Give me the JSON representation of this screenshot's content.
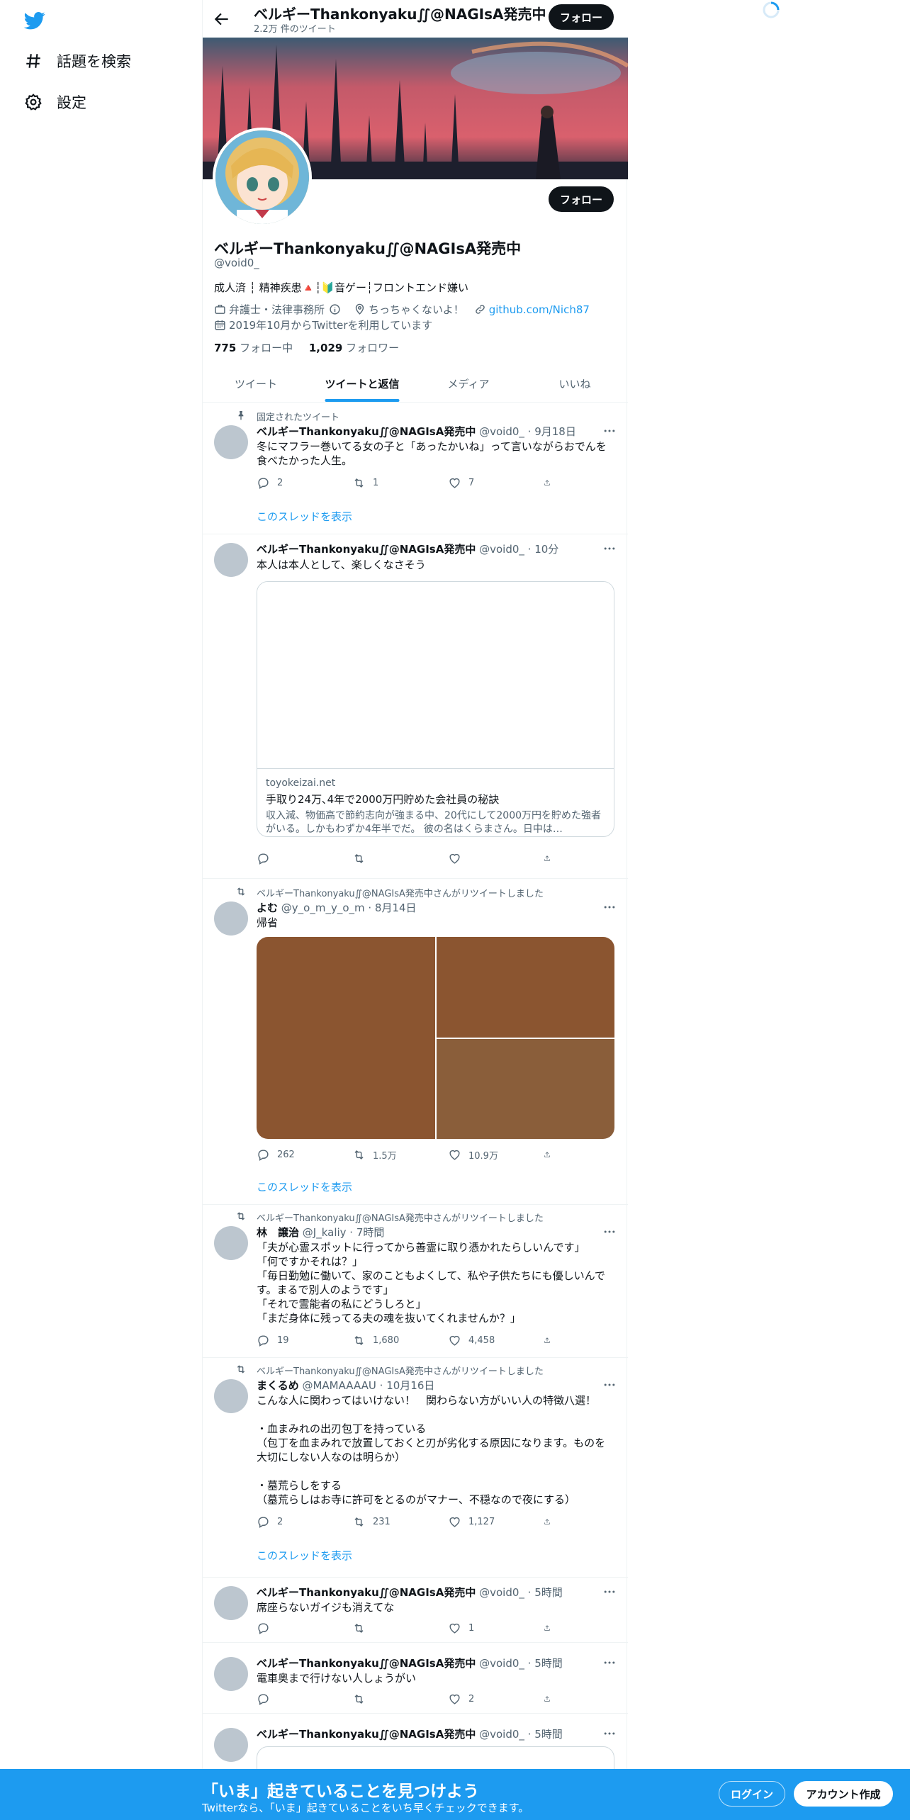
{
  "nav": {
    "explore_label": "話題を検索",
    "settings_label": "設定"
  },
  "header": {
    "name": "ベルギーThankonyaku∬@NAGIsA発売中",
    "tweet_count": "2.2万 件のツイート",
    "follow_label": "フォロー"
  },
  "profile": {
    "name": "ベルギーThankonyaku∬@NAGIsA発売中",
    "handle": "@void0_",
    "follow_label": "フォロー",
    "bio": "成人済 ┆ 精神疾患🔺┆🔰音ゲー┆フロントエンド嫌い",
    "category": "弁護士・法律事務所",
    "location": "ちっちゃくないよ！",
    "website": "github.com/Nich87",
    "joined": "2019年10月からTwitterを利用しています",
    "following_count": "775",
    "following_label": " フォロー中",
    "followers_count": "1,029",
    "followers_label": " フォロワー"
  },
  "tabs": [
    "ツイート",
    "ツイートと返信",
    "メディア",
    "いいね"
  ],
  "tweets": [
    {
      "context": "固定されたツイート",
      "name": "ベルギーThankonyaku∬@NAGIsA発売中",
      "handle_time": " @void0_ · 9月18日",
      "text": "冬にマフラー巻いてる女の子と「あったかいね」って言いながらおでんを食べたかった人生。",
      "reply": "2",
      "retweet": "1",
      "like": "7",
      "show_thread": "このスレッドを表示"
    },
    {
      "name": "ベルギーThankonyaku∬@NAGIsA発売中",
      "handle_time": " @void0_ · 10分",
      "text": "本人は本人として、楽しくなさそう",
      "card_domain": "toyokeizai.net",
      "card_title": "手取り24万､4年で2000万円貯めた会社員の秘訣",
      "card_desc": "収入減、物価高で節約志向が強まる中、20代にして2000万円を貯めた強者がいる。しかもわずか4年半でだ。 彼の名はくらまさん。日中は…",
      "reply": "",
      "retweet": "",
      "like": ""
    },
    {
      "context": "ベルギーThankonyaku∬@NAGIsA発売中さんがリツイートしました",
      "name": "よむ",
      "handle_time": " @y_o_m_y_o_m · 8月14日",
      "text": "帰省",
      "reply": "262",
      "retweet": "1.5万",
      "like": "10.9万",
      "show_thread": "このスレッドを表示",
      "media_colors": [
        "#8b5530",
        "#8b5530",
        "#8a5e3a"
      ]
    },
    {
      "context": "ベルギーThankonyaku∬@NAGIsA発売中さんがリツイートしました",
      "name": "林　譲治",
      "handle_time": " @J_kaliy · 7時間",
      "text": "「夫が心霊スポットに行ってから善霊に取り憑かれたらしいんです」\n「何ですかそれは？」\n「毎日勤勉に働いて、家のこともよくして、私や子供たちにも優しいんです。まるで別人のようです」\n「それで霊能者の私にどうしろと」\n「まだ身体に残ってる夫の魂を抜いてくれませんか？」",
      "reply": "19",
      "retweet": "1,680",
      "like": "4,458"
    },
    {
      "context": "ベルギーThankonyaku∬@NAGIsA発売中さんがリツイートしました",
      "name": "まくるめ",
      "handle_time": " @MAMAAAAU · 10月16日",
      "text": "こんな人に関わってはいけない！　関わらない方がいい人の特徴八選！\n\n・血まみれの出刃包丁を持っている\n（包丁を血まみれで放置しておくと刃が劣化する原因になります。ものを大切にしない人なのは明らか）\n\n・墓荒らしをする\n（墓荒らしはお寺に許可をとるのがマナー、不穏なので夜にする）",
      "reply": "2",
      "retweet": "231",
      "like": "1,127",
      "show_thread": "このスレッドを表示"
    },
    {
      "name": "ベルギーThankonyaku∬@NAGIsA発売中",
      "handle_time": " @void0_ · 5時間",
      "text": "席座らないガイジも消えてな",
      "reply": "",
      "retweet": "",
      "like": "1"
    },
    {
      "name": "ベルギーThankonyaku∬@NAGIsA発売中",
      "handle_time": " @void0_ · 5時間",
      "text": "電車奥まで行けない人しょうがい",
      "reply": "",
      "retweet": "",
      "like": "2"
    },
    {
      "name": "ベルギーThankonyaku∬@NAGIsA発売中",
      "handle_time": " @void0_ · 5時間",
      "text": ""
    }
  ],
  "bottom_bar": {
    "title": "「いま」起きていることを見つけよう",
    "subtitle": "Twitterなら、「いま」起きていることをいち早くチェックできます。",
    "login_label": "ログイン",
    "signup_label": "アカウント作成"
  },
  "colors": {
    "accent": "#1d9bf0",
    "dark": "#0f1419",
    "muted": "#536471"
  }
}
